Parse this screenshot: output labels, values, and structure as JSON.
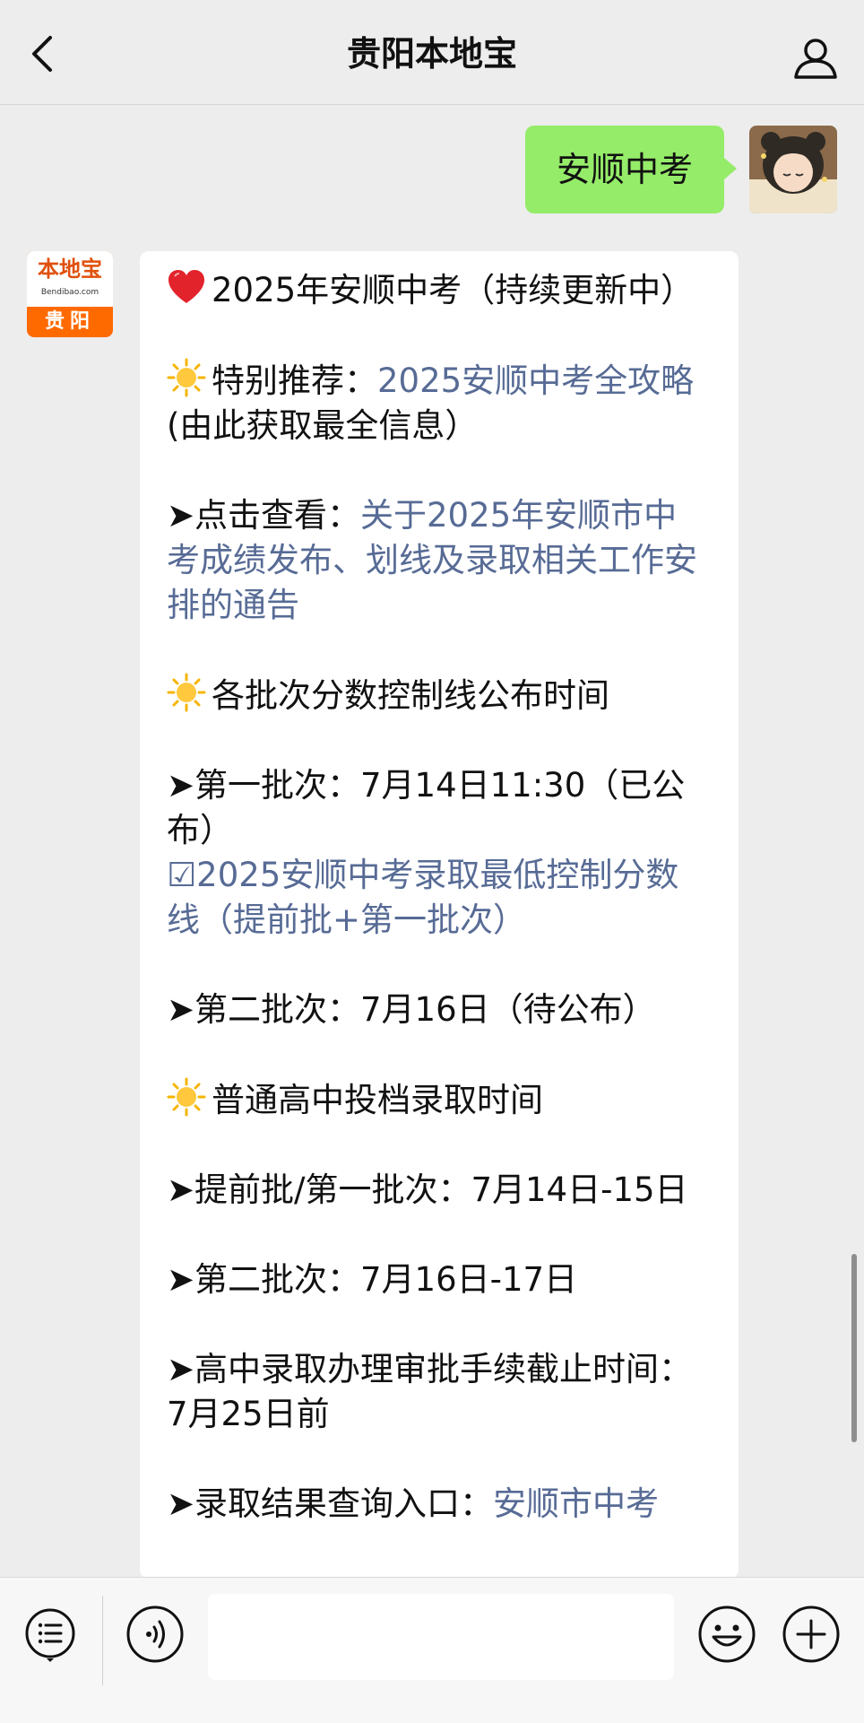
{
  "header": {
    "title": "贵阳本地宝"
  },
  "sent_message": {
    "text": "安顺中考"
  },
  "brand": {
    "name": "本地宝",
    "url": "Bendibao.com",
    "city": "贵阳"
  },
  "message": {
    "title": "2025年安顺中考（持续更新中）",
    "rec_label": "特别推荐：",
    "rec_link": "2025安顺中考全攻略",
    "rec_suffix": "(由此获取最全信息）",
    "view_label": "➤点击查看：",
    "view_link": "关于2025年安顺市中考成绩发布、划线及录取相关工作安排的通告",
    "section1": "各批次分数控制线公布时间",
    "batch1": "➤第一批次：7月14日11:30（已公布）",
    "batch1_link": "☑2025安顺中考录取最低控制分数线（提前批+第一批次）",
    "batch2": "➤第二批次：7月16日（待公布）",
    "section2": "普通高中投档录取时间",
    "admit1": "➤提前批/第一批次：7月14日-15日",
    "admit2": "➤第二批次：7月16日-17日",
    "deadline": "➤高中录取办理审批手续截止时间：7月25日前",
    "query_label": "➤录取结果查询入口：",
    "query_link": "安顺市中考"
  },
  "icons": {
    "back": "chevron-left-icon",
    "profile": "person-icon",
    "heart": "red-heart-emoji",
    "sun": "sun-emoji",
    "menu": "list-menu-icon",
    "voice": "voice-icon",
    "emoji": "smiley-icon",
    "plus": "plus-icon"
  },
  "colors": {
    "background": "#ededed",
    "sent_bubble": "#95ec69",
    "link": "#576b95",
    "brand": "#ff6a00"
  }
}
